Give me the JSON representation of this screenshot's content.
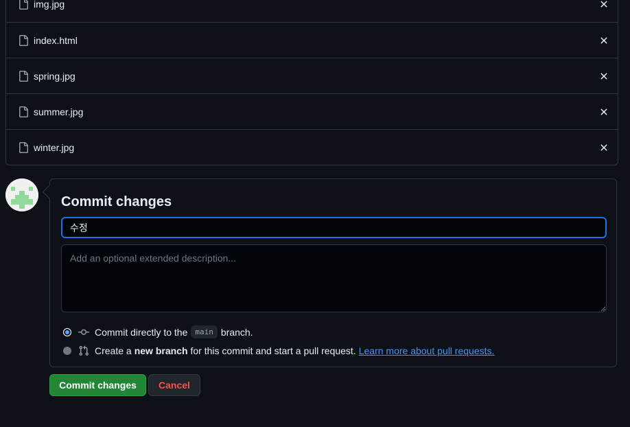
{
  "files": [
    {
      "name": "img.jpg"
    },
    {
      "name": "index.html"
    },
    {
      "name": "spring.jpg"
    },
    {
      "name": "summer.jpg"
    },
    {
      "name": "winter.jpg"
    }
  ],
  "commit": {
    "title": "Commit changes",
    "summary_value": "수정",
    "description_placeholder": "Add an optional extended description...",
    "option_direct": {
      "prefix": "Commit directly to the",
      "branch": "main",
      "suffix": "branch."
    },
    "option_new_branch": {
      "prefix": "Create a",
      "bold": "new branch",
      "suffix": "for this commit and start a pull request.",
      "link": "Learn more about pull requests."
    }
  },
  "buttons": {
    "commit_label": "Commit changes",
    "cancel_label": "Cancel"
  },
  "colors": {
    "background": "#0d1117",
    "border": "#30363d",
    "accent_blue": "#1f6feb",
    "link": "#4493f8",
    "commit_green": "#238636",
    "cancel_red": "#f85149"
  }
}
